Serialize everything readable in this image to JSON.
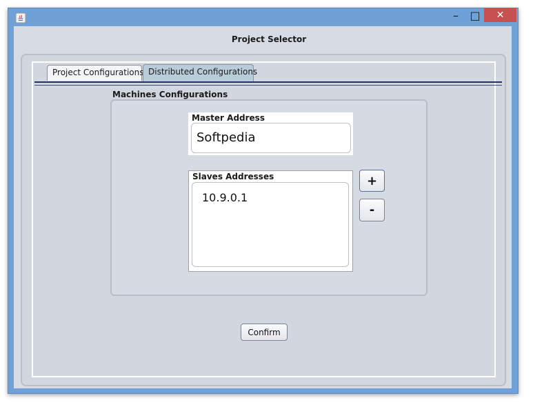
{
  "window": {
    "title": "Project Selector",
    "controls": {
      "minimize": "–",
      "maximize": "□",
      "close": "✕"
    },
    "icon": "java-icon"
  },
  "tabs": [
    {
      "label": "Project Configurations",
      "selected": false
    },
    {
      "label": "Distributed Configurations",
      "selected": true
    }
  ],
  "machines": {
    "section_label": "Machines Configurations",
    "master": {
      "label": "Master Address",
      "value": "Softpedia"
    },
    "slaves": {
      "label": "Slaves Addresses",
      "items": [
        "10.9.0.1"
      ]
    },
    "add_label": "+",
    "remove_label": "-"
  },
  "confirm_label": "Confirm",
  "colors": {
    "title_bar": "#6fa1d6",
    "close_button": "#c75050",
    "panel_background": "#d7dbe3",
    "selected_tab": "#b9ccd9",
    "tab_underline": "#1d2f6e"
  }
}
